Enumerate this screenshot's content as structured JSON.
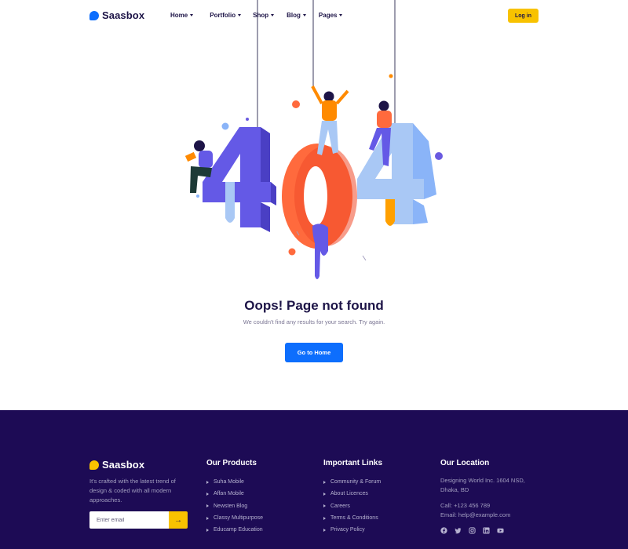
{
  "brand": {
    "name": "Saasbox",
    "accent": "#0d6efd",
    "footer_accent": "#f8c200"
  },
  "nav": {
    "items": [
      {
        "label": "Home"
      },
      {
        "label": "Portfolio"
      },
      {
        "label": "Shop"
      },
      {
        "label": "Blog"
      },
      {
        "label": "Pages"
      }
    ],
    "login_label": "Log in"
  },
  "error": {
    "code": "404",
    "title": "Oops! Page not found",
    "subtitle": "We couldn't find any results for your search. Try again.",
    "button_label": "Go to Home"
  },
  "footer": {
    "background": "#1d0b55",
    "logo": "Saasbox",
    "description": "It's crafted with the latest trend of design & coded with all modern approaches.",
    "email_placeholder": "Enter email",
    "products": {
      "title": "Our Products",
      "items": [
        "Suha Mobile",
        "Affan Mobile",
        "Newsten Blog",
        "Classy Multipurpose",
        "Educamp Education"
      ]
    },
    "links": {
      "title": "Important Links",
      "items": [
        "Community & Forum",
        "About Licences",
        "Careers",
        "Terms & Conditions",
        "Privacy Policy"
      ]
    },
    "location": {
      "title": "Our Location",
      "address_1": "Designing World Inc. 1604 NSD,",
      "address_2": "Dhaka, BD",
      "phone": "Call: +123 456 789",
      "email": "Email: help@example.com",
      "social_icons": [
        "facebook-icon",
        "twitter-icon",
        "instagram-icon",
        "linkedin-icon",
        "youtube-icon"
      ]
    }
  }
}
